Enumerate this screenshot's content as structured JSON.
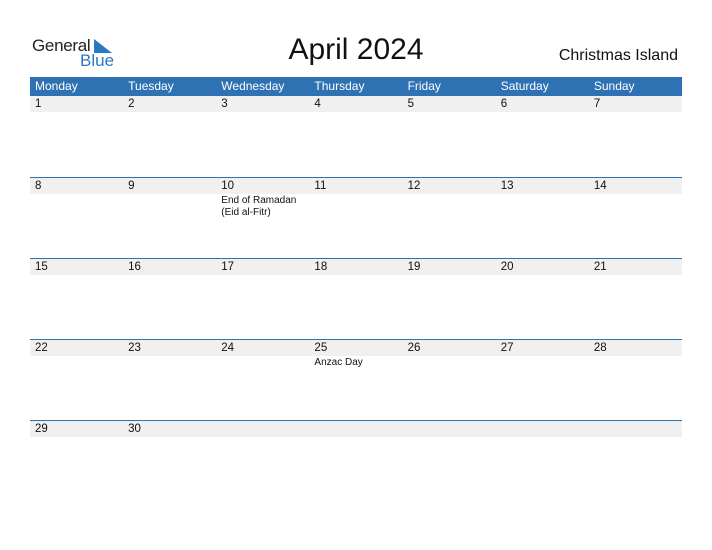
{
  "logo": {
    "word1": "General",
    "word2": "Blue",
    "accent_color": "#2a7abf"
  },
  "title": "April 2024",
  "region": "Christmas Island",
  "weekdays": [
    "Monday",
    "Tuesday",
    "Wednesday",
    "Thursday",
    "Friday",
    "Saturday",
    "Sunday"
  ],
  "weeks": [
    [
      {
        "d": "1"
      },
      {
        "d": "2"
      },
      {
        "d": "3"
      },
      {
        "d": "4"
      },
      {
        "d": "5"
      },
      {
        "d": "6"
      },
      {
        "d": "7"
      }
    ],
    [
      {
        "d": "8"
      },
      {
        "d": "9"
      },
      {
        "d": "10",
        "h": "End of Ramadan (Eid al-Fitr)"
      },
      {
        "d": "11"
      },
      {
        "d": "12"
      },
      {
        "d": "13"
      },
      {
        "d": "14"
      }
    ],
    [
      {
        "d": "15"
      },
      {
        "d": "16"
      },
      {
        "d": "17"
      },
      {
        "d": "18"
      },
      {
        "d": "19"
      },
      {
        "d": "20"
      },
      {
        "d": "21"
      }
    ],
    [
      {
        "d": "22"
      },
      {
        "d": "23"
      },
      {
        "d": "24"
      },
      {
        "d": "25",
        "h": "Anzac Day"
      },
      {
        "d": "26"
      },
      {
        "d": "27"
      },
      {
        "d": "28"
      }
    ],
    [
      {
        "d": "29"
      },
      {
        "d": "30"
      },
      {
        "d": ""
      },
      {
        "d": ""
      },
      {
        "d": ""
      },
      {
        "d": ""
      },
      {
        "d": ""
      }
    ]
  ],
  "colors": {
    "header_bg": "#2f72b3",
    "day_band": "#f0f0f0"
  }
}
